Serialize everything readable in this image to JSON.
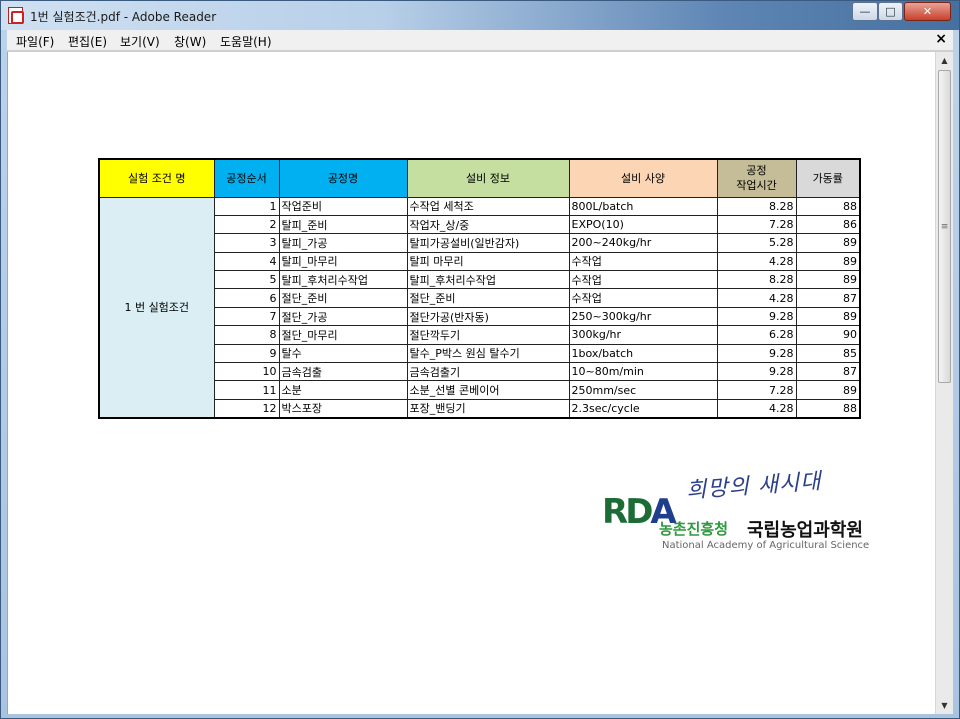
{
  "window": {
    "title": "1번 실험조건.pdf - Adobe Reader",
    "controls": {
      "minimize": "—",
      "maximize": "□",
      "close": "✕"
    }
  },
  "menu": {
    "items": [
      "파일(F)",
      "편집(E)",
      "보기(V)",
      "창(W)",
      "도움말(H)"
    ],
    "close_doc": "×"
  },
  "scrollbar": {
    "up": "▲",
    "down": "▼",
    "grip": "≡"
  },
  "table": {
    "headers": {
      "condition": "실험 조건 명",
      "order": "공정순서",
      "process": "공정명",
      "equipment": "설비 정보",
      "spec": "설비 사양",
      "time_line1": "공정",
      "time_line2": "작업시간",
      "rate": "가동률"
    },
    "condition_name": "1 번 실험조건",
    "rows": [
      {
        "order": "1",
        "process": "작업준비",
        "equipment": "수작업 세척조",
        "spec": "800L/batch",
        "time": "8.28",
        "rate": "88"
      },
      {
        "order": "2",
        "process": "탈피_준비",
        "equipment": "작업자_상/중",
        "spec": "EXPO(10)",
        "time": "7.28",
        "rate": "86"
      },
      {
        "order": "3",
        "process": "탈피_가공",
        "equipment": "탈피가공설비(일반감자)",
        "spec": "200~240kg/hr",
        "time": "5.28",
        "rate": "89"
      },
      {
        "order": "4",
        "process": "탈피_마무리",
        "equipment": "탈피 마무리",
        "spec": "수작업",
        "time": "4.28",
        "rate": "89"
      },
      {
        "order": "5",
        "process": "탈피_후처리수작업",
        "equipment": "탈피_후처리수작업",
        "spec": "수작업",
        "time": "8.28",
        "rate": "89"
      },
      {
        "order": "6",
        "process": "절단_준비",
        "equipment": "절단_준비",
        "spec": "수작업",
        "time": "4.28",
        "rate": "87"
      },
      {
        "order": "7",
        "process": "절단_가공",
        "equipment": "절단가공(반자동)",
        "spec": "250~300kg/hr",
        "time": "9.28",
        "rate": "89"
      },
      {
        "order": "8",
        "process": "절단_마무리",
        "equipment": "절단깍두기",
        "spec": "300kg/hr",
        "time": "6.28",
        "rate": "90"
      },
      {
        "order": "9",
        "process": "탈수",
        "equipment": "탈수_P박스 원심 탈수기",
        "spec": "1box/batch",
        "time": "9.28",
        "rate": "85"
      },
      {
        "order": "10",
        "process": "금속검출",
        "equipment": "금속검출기",
        "spec": "10~80m/min",
        "time": "9.28",
        "rate": "87"
      },
      {
        "order": "11",
        "process": "소분",
        "equipment": "소분_선별 콘베이어",
        "spec": "250mm/sec",
        "time": "7.28",
        "rate": "89"
      },
      {
        "order": "12",
        "process": "박스포장",
        "equipment": "포장_밴딩기",
        "spec": "2.3sec/cycle",
        "time": "4.28",
        "rate": "88"
      }
    ]
  },
  "logo": {
    "slogan": "희망의 새시대",
    "rda_r": "R",
    "rda_d": "D",
    "rda_a": "A",
    "org_rda": "농촌진흥청",
    "org_name": "국립농업과학원",
    "org_english": "National Academy of Agricultural Science"
  }
}
